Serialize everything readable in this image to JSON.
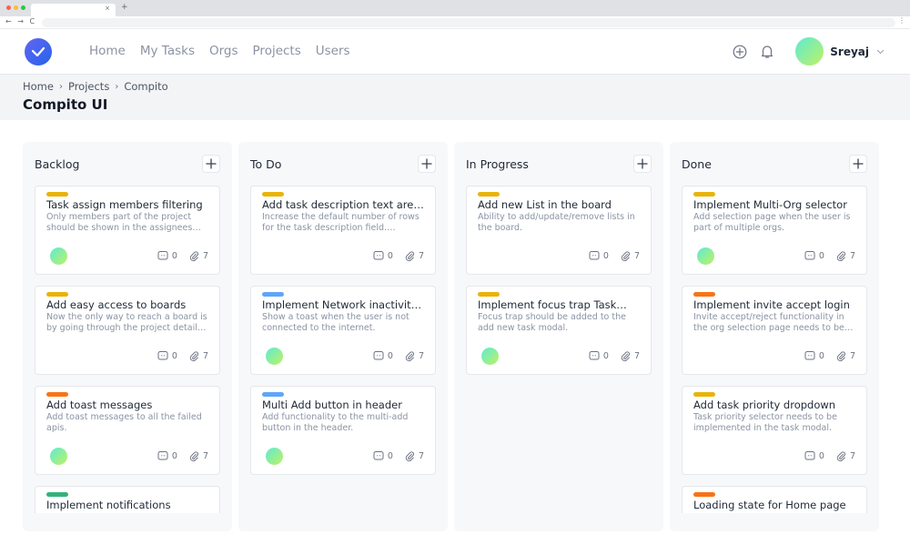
{
  "browser": {
    "tab_close": "×",
    "new_tab": "+",
    "nav_controls": "← → C",
    "menu": "⋮",
    "traffic_lights": [
      "#ff5f57",
      "#febc2e",
      "#28c840"
    ]
  },
  "header": {
    "logo_icon": "check-icon",
    "nav": [
      "Home",
      "My Tasks",
      "Orgs",
      "Projects",
      "Users"
    ],
    "add_icon": "plus-circle-icon",
    "notification_icon": "bell-icon",
    "user": {
      "name": "Sreyaj",
      "avatar": "gradient-avatar"
    }
  },
  "breadcrumb": [
    "Home",
    "Projects",
    "Compito"
  ],
  "breadcrumb_separator": "›",
  "page_title": "Compito UI",
  "colors": {
    "accent": "#4f46e5",
    "priority_yellow": "#eab308",
    "priority_orange": "#f97316",
    "priority_blue": "#60a5fa",
    "priority_green": "#34b27b"
  },
  "columns": [
    {
      "title": "Backlog",
      "add_label": "+",
      "cards": [
        {
          "priority": "#eab308",
          "title": "Task assign members filtering",
          "desc": "Only members part of the project should be shown in the assignees list…",
          "has_assignee": true,
          "comments": "0",
          "attachments": "7"
        },
        {
          "priority": "#eab308",
          "title": "Add easy access to boards",
          "desc": "Now the only way to reach a board is by going through the project detail…",
          "has_assignee": false,
          "comments": "0",
          "attachments": "7"
        },
        {
          "priority": "#f97316",
          "title": "Add toast messages",
          "desc": "Add toast messages to all the failed apis.",
          "has_assignee": true,
          "comments": "0",
          "attachments": "7"
        },
        {
          "priority": "#34b27b",
          "title": "Implement notifications",
          "partial": true
        }
      ]
    },
    {
      "title": "To Do",
      "add_label": "+",
      "cards": [
        {
          "priority": "#eab308",
          "title": "Add task description text area…",
          "desc": "Increase the default number of rows for the task description field. Conside…",
          "has_assignee": false,
          "comments": "0",
          "attachments": "7"
        },
        {
          "priority": "#60a5fa",
          "title": "Implement Network inactivity…",
          "desc": "Show a toast when the user is not connected to the internet.",
          "has_assignee": true,
          "comments": "0",
          "attachments": "7"
        },
        {
          "priority": "#60a5fa",
          "title": "Multi Add button in header",
          "desc": "Add functionality to the multi-add button in the header.",
          "has_assignee": true,
          "comments": "0",
          "attachments": "7"
        }
      ]
    },
    {
      "title": "In Progress",
      "add_label": "+",
      "cards": [
        {
          "priority": "#eab308",
          "title": "Add new List in the board",
          "desc": "Ability to add/update/remove lists in the board.",
          "has_assignee": false,
          "comments": "0",
          "attachments": "7"
        },
        {
          "priority": "#eab308",
          "title": "Implement focus trap Task…",
          "desc": "Focus trap should be added to the add new task modal.",
          "has_assignee": true,
          "comments": "0",
          "attachments": "7"
        }
      ]
    },
    {
      "title": "Done",
      "add_label": "+",
      "cards": [
        {
          "priority": "#eab308",
          "title": "Implement Multi-Org selector",
          "desc": "Add selection page when the user is part of multiple orgs.",
          "has_assignee": true,
          "comments": "0",
          "attachments": "7"
        },
        {
          "priority": "#f97316",
          "title": "Implement invite accept login",
          "desc": "Invite accept/reject functionality in the org selection page needs to be…",
          "has_assignee": false,
          "comments": "0",
          "attachments": "7"
        },
        {
          "priority": "#eab308",
          "title": "Add task priority dropdown",
          "desc": "Task priority selector needs to be implemented in the task modal.",
          "has_assignee": false,
          "comments": "0",
          "attachments": "7"
        },
        {
          "priority": "#f97316",
          "title": "Loading state for Home page",
          "partial": true
        }
      ]
    }
  ]
}
